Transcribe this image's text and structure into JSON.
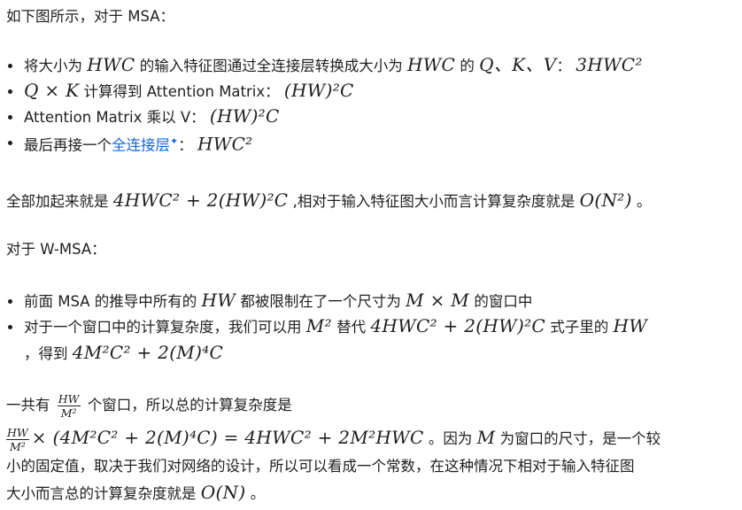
{
  "intro_msa": "如下图所示，对于 MSA：",
  "msa_bullets": [
    {
      "t1": "将大小为 ",
      "m1": "HWC",
      "t2": " 的输入特征图通过全连接层转换成大小为 ",
      "m2": "HWC",
      "t3": " 的 ",
      "m3": "Q、K、V",
      "t4": "： ",
      "m4": "3HWC²"
    },
    {
      "m1": "Q × K",
      "t1": " 计算得到 Attention Matrix： ",
      "m2": "(HW)²C"
    },
    {
      "t1": "Attention Matrix 乘以 V： ",
      "m1": "(HW)²C"
    },
    {
      "t1": "最后再接一个",
      "link": "全连接层",
      "spark": "✦",
      "t2": "： ",
      "m1": "HWC²"
    }
  ],
  "msa_summary": {
    "t1": "全部加起来就是 ",
    "m1": "4HWC² + 2(HW)²C",
    "t2": " ,相对于输入特征图大小而言计算复杂度就是 ",
    "m2": "O(N²)",
    "t3": " 。"
  },
  "intro_wmsa": "对于 W-MSA：",
  "wmsa_bullets": [
    {
      "t1": "前面 MSA 的推导中所有的 ",
      "m1": "HW",
      "t2": " 都被限制在了一个尺寸为 ",
      "m2": "M × M",
      "t3": " 的窗口中"
    },
    {
      "t1": "对于一个窗口中的计算复杂度，我们可以用 ",
      "m1": "M²",
      "t2": " 替代 ",
      "m2": "4HWC² + 2(HW)²C",
      "t3": " 式子里的 ",
      "m3": "HW",
      "t4": "，得到 ",
      "m4": "4M²C² + 2(M)⁴C"
    }
  ],
  "windows_line": {
    "t1": "一共有 ",
    "frac_num": "HW",
    "frac_den": "M²",
    "t2": " 个窗口，所以总的计算复杂度是"
  },
  "final_para": {
    "frac_num": "HW",
    "frac_den": "M²",
    "m1": "× (4M²C² + 2(M)⁴C) = 4HWC² + 2M²HWC",
    "t1": " 。因为 ",
    "m2": "M",
    "t2": " 为窗口的尺寸，是一个较",
    "line2": "小的固定值，取决于我们对网络的设计，所以可以看成一个常数，在这种情况下相对于输入特征图",
    "line3_t": "大小而言总的计算复杂度就是 ",
    "line3_m": "O(N)",
    "line3_end": " 。"
  }
}
